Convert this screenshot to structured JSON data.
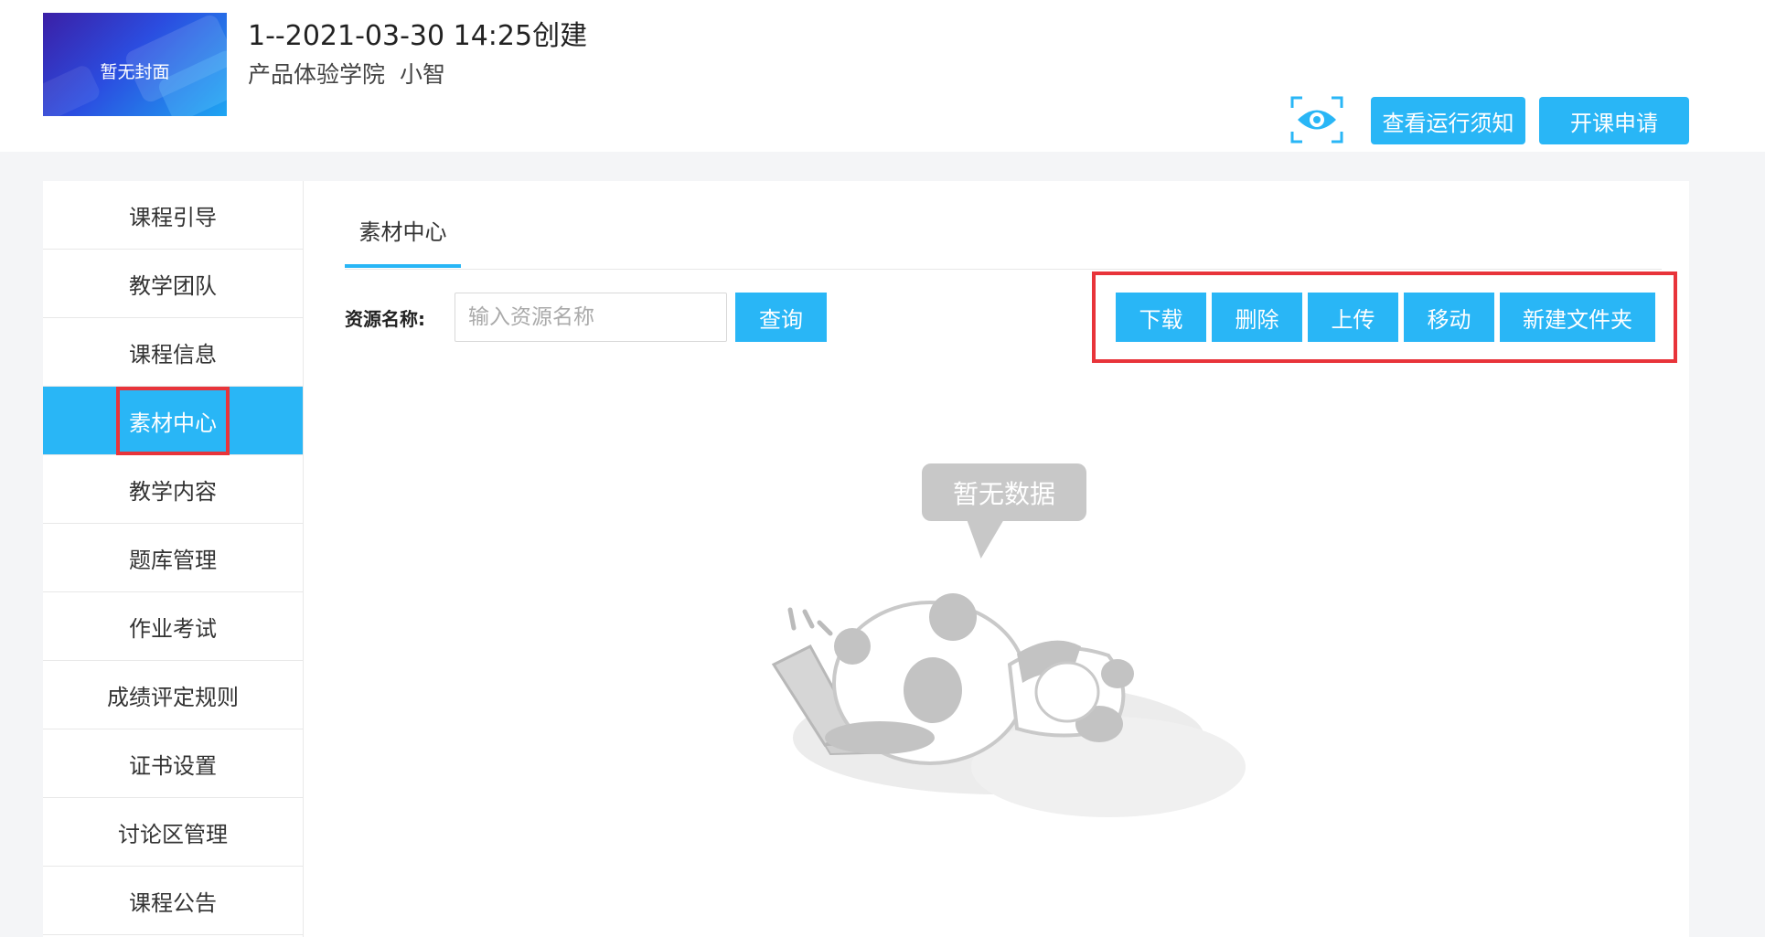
{
  "header": {
    "cover_text": "暂无封面",
    "title": "1--2021-03-30 14:25创建",
    "institution": "产品体验学院",
    "teacher": "小智",
    "preview_icon": "eye-icon",
    "btn_notice": "查看运行须知",
    "btn_apply": "开课申请"
  },
  "sidebar": {
    "items": [
      {
        "label": "课程引导"
      },
      {
        "label": "教学团队"
      },
      {
        "label": "课程信息"
      },
      {
        "label": "素材中心",
        "active": true
      },
      {
        "label": "教学内容"
      },
      {
        "label": "题库管理"
      },
      {
        "label": "作业考试"
      },
      {
        "label": "成绩评定规则"
      },
      {
        "label": "证书设置"
      },
      {
        "label": "讨论区管理"
      },
      {
        "label": "课程公告"
      }
    ]
  },
  "main": {
    "tab": "素材中心",
    "search_label": "资源名称:",
    "search_placeholder": "输入资源名称",
    "search_value": "",
    "btn_query": "查询",
    "actions": {
      "download": "下载",
      "delete": "删除",
      "upload": "上传",
      "move": "移动",
      "new_folder": "新建文件夹"
    },
    "empty_text": "暂无数据"
  },
  "colors": {
    "accent": "#29b6f6",
    "highlight": "#e8343a"
  }
}
